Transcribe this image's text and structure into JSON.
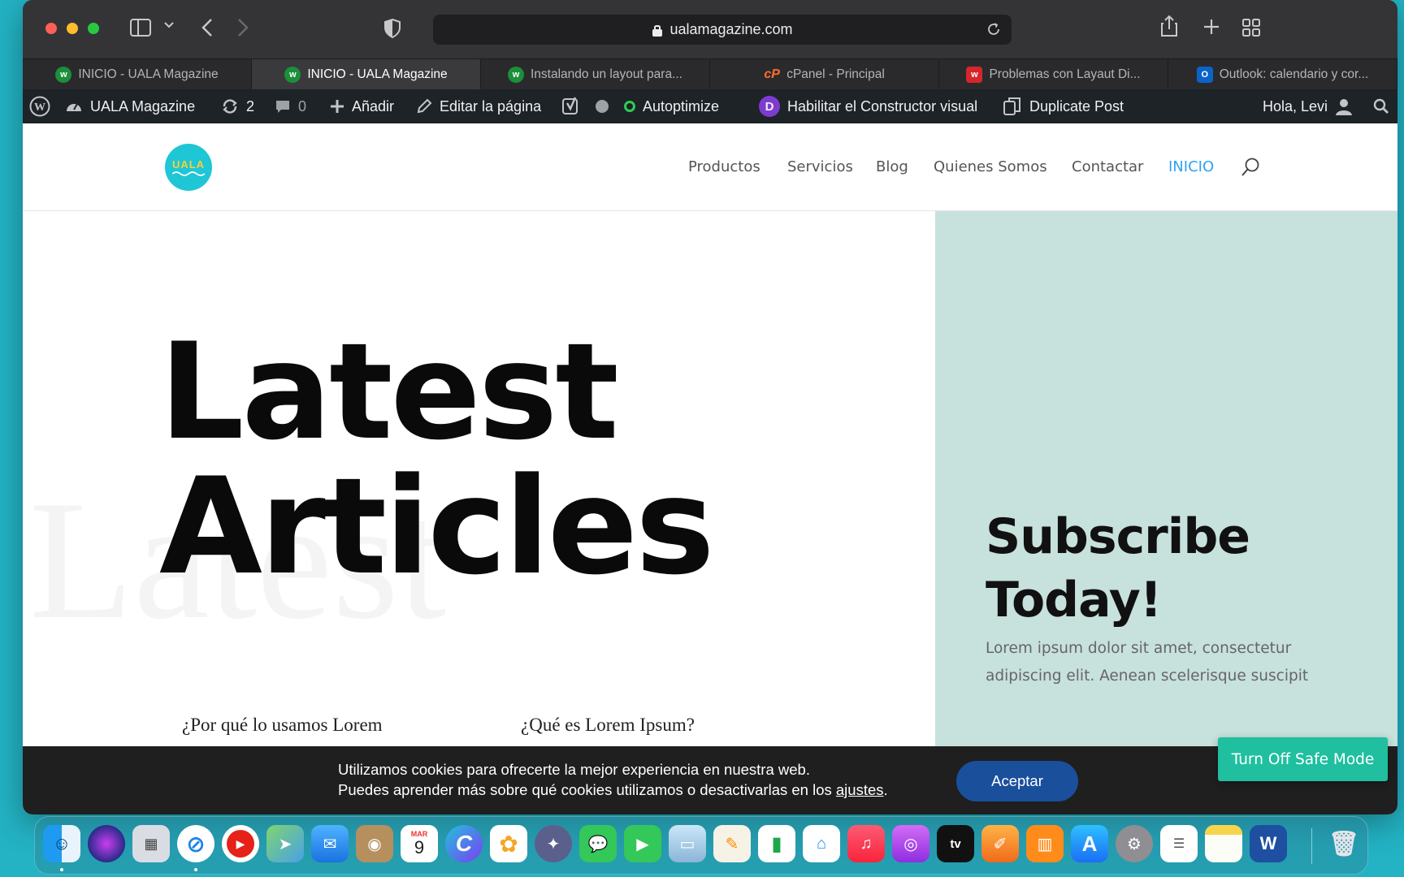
{
  "browser": {
    "url": "ualamagazine.com",
    "tabs": [
      {
        "title": "INICIO - UALA Magazine",
        "icon": "uala-favicon",
        "active": false
      },
      {
        "title": "INICIO - UALA Magazine",
        "icon": "uala-favicon",
        "active": true
      },
      {
        "title": "Instalando un layout para...",
        "icon": "uala-favicon",
        "active": false
      },
      {
        "title": "cPanel - Principal",
        "icon": "cpanel-favicon",
        "active": false
      },
      {
        "title": "Problemas con Layaut Di...",
        "icon": "red-w-favicon",
        "active": false
      },
      {
        "title": "Outlook: calendario y cor...",
        "icon": "outlook-favicon",
        "active": false
      }
    ]
  },
  "wp_admin_bar": {
    "site_name": "UALA Magazine",
    "updates_count": "2",
    "comments_count": "0",
    "add_new": "Añadir",
    "edit_page": "Editar la página",
    "autoptimize": "Autoptimize",
    "divi_builder": "Habilitar el Constructor visual",
    "duplicate_post": "Duplicate Post",
    "greeting": "Hola, Levi"
  },
  "site": {
    "logo_text": "UALA",
    "nav": [
      "Productos",
      "Servicios",
      "Blog",
      "Quienes Somos",
      "Contactar",
      "INICIO"
    ],
    "active_nav": "INICIO",
    "hero_line1": "Latest",
    "hero_line2": "Articles",
    "hero_ghost": "Latest",
    "posts": [
      "¿Por qué lo usamos Lorem",
      "¿Qué es Lorem Ipsum?"
    ],
    "subscribe_line1": "Subscribe",
    "subscribe_line2": "Today!",
    "subscribe_text": "Lorem ipsum dolor sit amet, consectetur adipiscing elit. Aenean scelerisque suscipit"
  },
  "cookie": {
    "line1": "Utilizamos cookies para ofrecerte la mejor experiencia en nuestra web.",
    "line2_prefix": "Puedes aprender más sobre qué cookies utilizamos o desactivarlas en los ",
    "link": "ajustes",
    "line2_suffix": ".",
    "accept": "Aceptar"
  },
  "safe_mode_button": "Turn Off Safe Mode",
  "calendar_icon": {
    "month": "MAR",
    "day": "9"
  },
  "colors": {
    "accent_blue": "#2ea3f2",
    "subscribe_bg": "#c7e1dd",
    "accept_button": "#1a4f9c",
    "safe_mode": "#1fbfa0"
  }
}
